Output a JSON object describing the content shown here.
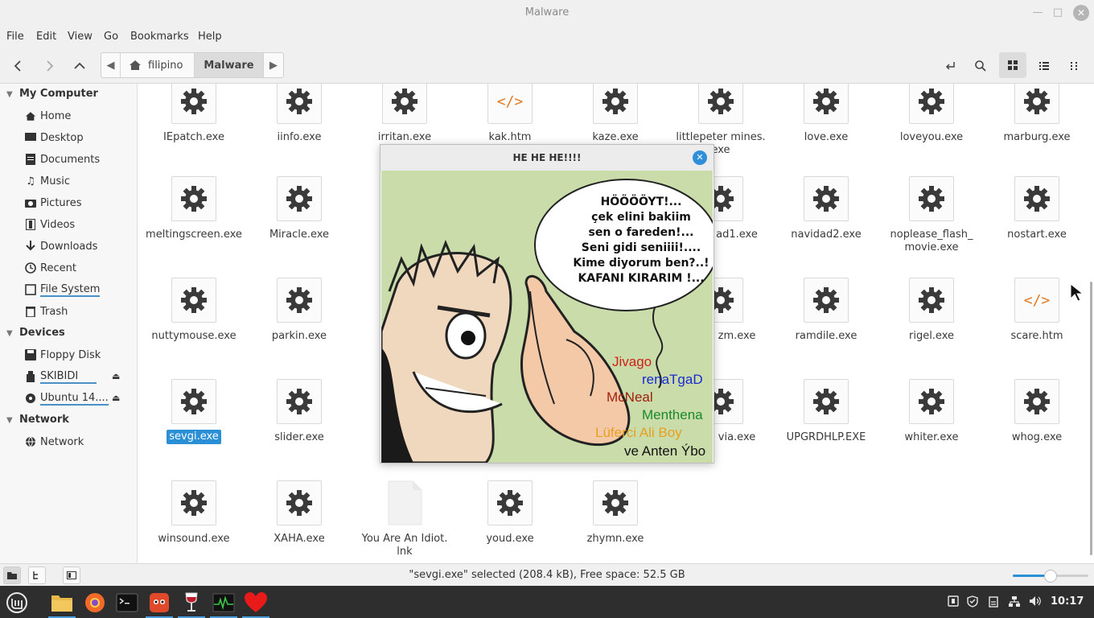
{
  "window": {
    "title": "Malware"
  },
  "menu": [
    "File",
    "Edit",
    "View",
    "Go",
    "Bookmarks",
    "Help"
  ],
  "path": {
    "segments": [
      "filipino",
      "Malware"
    ]
  },
  "sidebar": {
    "my_computer": {
      "label": "My Computer",
      "items": [
        "Home",
        "Desktop",
        "Documents",
        "Music",
        "Pictures",
        "Videos",
        "Downloads",
        "Recent",
        "File System",
        "Trash"
      ]
    },
    "devices": {
      "label": "Devices",
      "items": [
        "Floppy Disk",
        "SKIBIDI",
        "Ubuntu 14...."
      ]
    },
    "network": {
      "label": "Network",
      "items": [
        "Network"
      ]
    }
  },
  "files": {
    "row1": [
      "IEpatch.exe",
      "iinfo.exe",
      "irritan.exe",
      "kak.htm",
      "kaze.exe",
      "littlepeter mines.",
      "love.exe",
      "loveyou.exe",
      "marburg.exe"
    ],
    "row1_extra": "exe",
    "row2": [
      "meltingscreen.exe",
      "Miracle.exe",
      "ad1.exe",
      "navidad2.exe",
      "noplease_flash_",
      "nostart.exe"
    ],
    "row2_extra": "movie.exe",
    "row3": [
      "nuttymouse.exe",
      "parkin.exe",
      "zm.exe",
      "ramdile.exe",
      "rigel.exe",
      "scare.htm"
    ],
    "row4": [
      "sevgi.exe",
      "slider.exe",
      "via.exe",
      "UPGRDHLP.EXE",
      "whiter.exe",
      "whog.exe"
    ],
    "row5": [
      "winsound.exe",
      "XAHA.exe",
      "You Are An Idiot.",
      "youd.exe",
      "zhymn.exe"
    ],
    "row5_extra": "lnk",
    "htm_glyph": "</>"
  },
  "popup": {
    "title": "HE HE HE!!!!",
    "bubble_lines": [
      "HÖÖÖÖYT!...",
      "çek elini bakiim",
      "sen o fareden!...",
      "Seni gidi seniiii!....",
      "Kime diyorum ben?..!",
      "KAFANI KIRARIM !..."
    ],
    "credits": [
      {
        "text": "Jivago",
        "color": "#d0201a"
      },
      {
        "text": "renaTgaD",
        "color": "#1a2ad0"
      },
      {
        "text": "McNeal",
        "color": "#a02010"
      },
      {
        "text": "Menthena",
        "color": "#1a8a2a"
      },
      {
        "text": "Lüferci Ali Boy",
        "color": "#e8a020"
      },
      {
        "text": "ve Anten Ýbo",
        "color": "#111111"
      }
    ]
  },
  "status": {
    "text": "\"sevgi.exe\" selected (208.4 kB), Free space: 52.5 GB",
    "zoom_level": 0.5
  },
  "taskbar": {
    "clock": "10:17"
  }
}
